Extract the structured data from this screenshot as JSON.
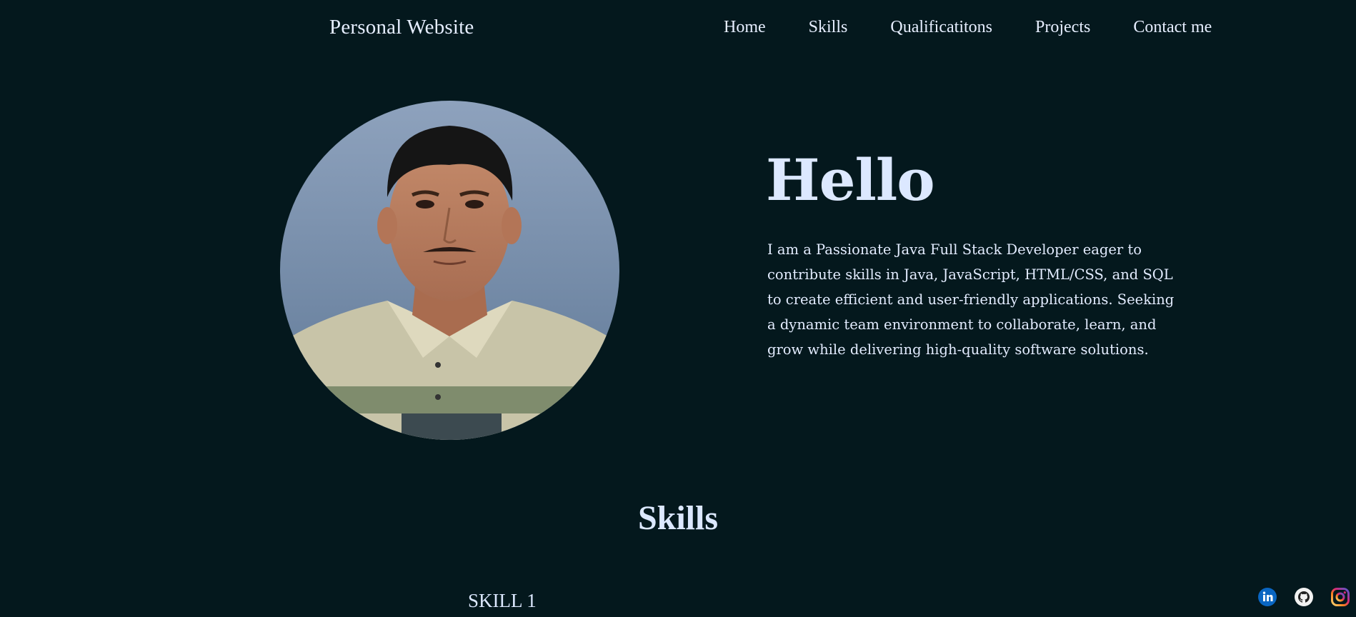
{
  "header": {
    "brand": "Personal Website",
    "nav": [
      {
        "label": "Home"
      },
      {
        "label": "Skills"
      },
      {
        "label": "Qualificatitons"
      },
      {
        "label": "Projects"
      },
      {
        "label": "Contact me"
      }
    ]
  },
  "hero": {
    "title": "Hello",
    "description": "I am a Passionate Java Full Stack Developer eager to contribute skills in Java, JavaScript, HTML/CSS, and SQL to create efficient and user-friendly applications. Seeking a dynamic team environment to collaborate, learn, and grow while delivering high-quality software solutions.",
    "avatar_icon": "profile-photo"
  },
  "skills": {
    "title": "Skills",
    "items": [
      {
        "label": "SKILL 1"
      }
    ]
  },
  "social": [
    {
      "icon": "linkedin-icon"
    },
    {
      "icon": "github-icon"
    },
    {
      "icon": "instagram-icon"
    }
  ],
  "colors": {
    "background": "#04181d",
    "text": "#dce8ff",
    "linkedin": "#0a66c2"
  }
}
